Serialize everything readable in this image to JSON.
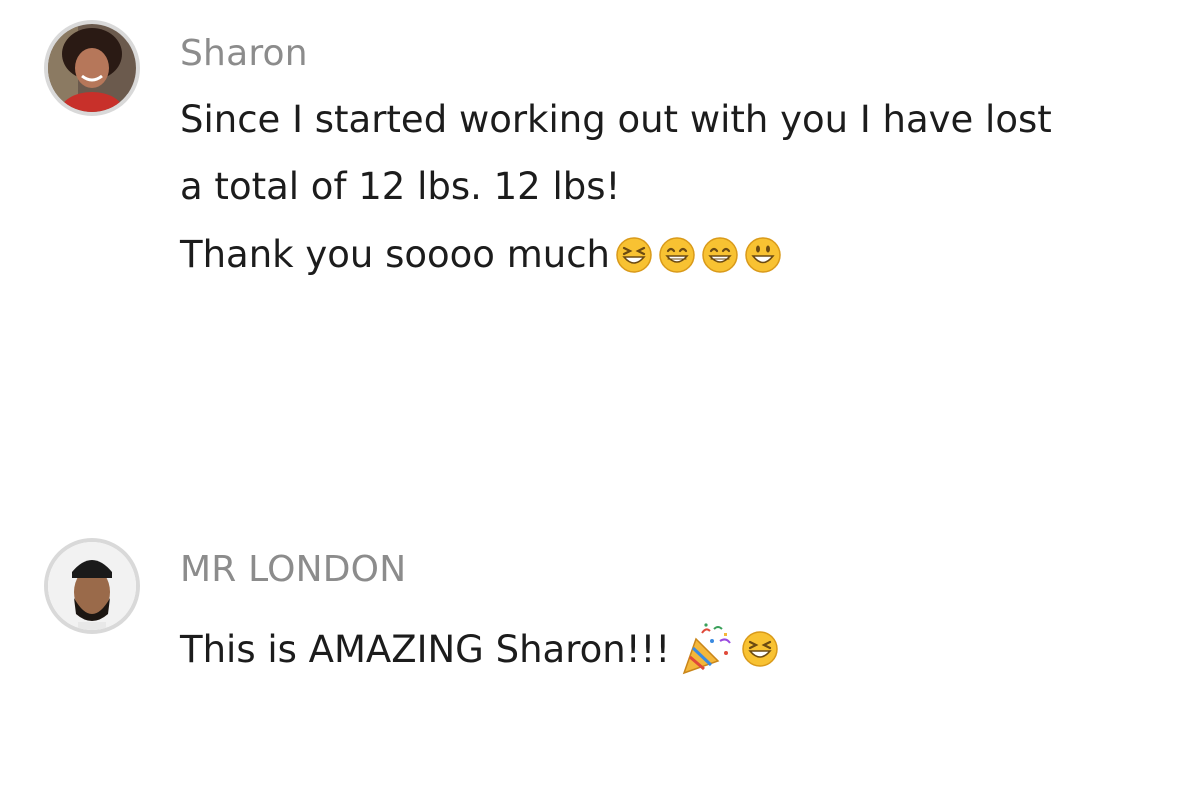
{
  "comments": [
    {
      "author": "Sharon",
      "avatar_icon": "avatar-woman-red-top",
      "lines": [
        "Since I started working out with you I have lost",
        "a total of 12 lbs. 12 lbs!",
        "Thank you soooo much"
      ],
      "emojis": [
        "laughing-face-icon",
        "grinning-face-icon",
        "grinning-face-icon",
        "smiling-face-icon"
      ]
    },
    {
      "author": "MR LONDON",
      "avatar_icon": "avatar-man-bandana",
      "lines": [
        "This is AMAZING Sharon!!!"
      ],
      "emojis": [
        "party-popper-icon",
        "laughing-face-icon"
      ]
    }
  ],
  "colors": {
    "author": "#8c8c8c",
    "text": "#1c1c1c",
    "avatar_border": "#d9d9d9",
    "emoji_face": "#f8c232"
  }
}
